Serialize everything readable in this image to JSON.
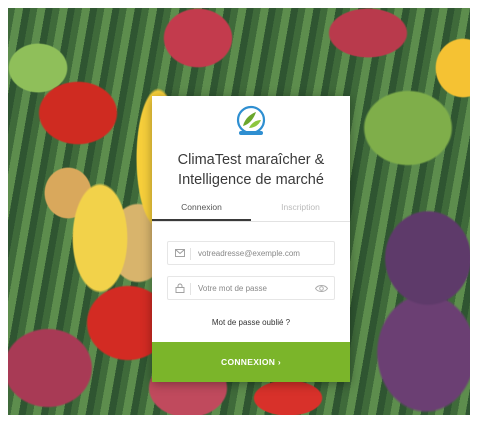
{
  "app": {
    "title_line1": "ClimaTest maraîcher &",
    "title_line2": "Intelligence de marché"
  },
  "tabs": [
    {
      "label": "Connexion",
      "active": true
    },
    {
      "label": "Inscription",
      "active": false
    }
  ],
  "form": {
    "email_placeholder": "votreadresse@exemple.com",
    "password_placeholder": "Votre mot de passe",
    "forgot_label": "Mot de passe oublié ?",
    "submit_label": "CONNEXION ›"
  },
  "icons": {
    "logo": "logo-icon",
    "email": "envelope-icon",
    "password": "lock-icon",
    "show_password": "eye-icon"
  },
  "colors": {
    "accent": "#7bb52a",
    "logo_blue": "#2f8fd1",
    "logo_green": "#6aa62c"
  }
}
